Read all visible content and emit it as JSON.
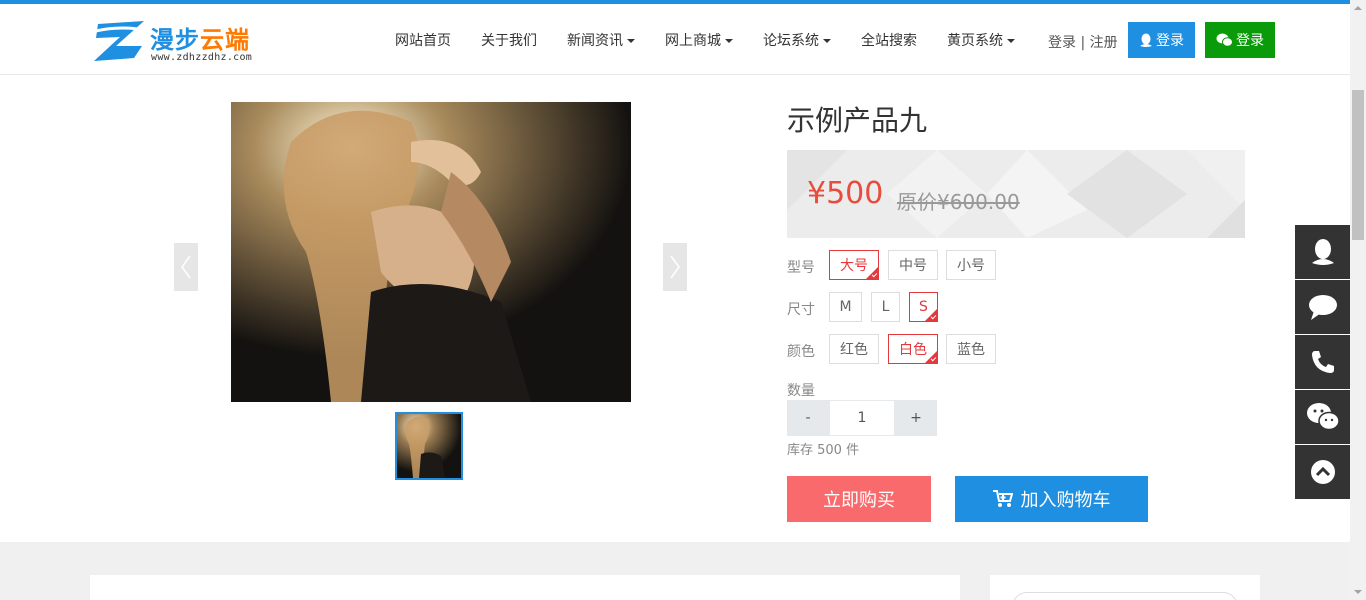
{
  "colors": {
    "accent": "#1e8fe1",
    "wechat_green": "#0a9a0a",
    "price_red": "#e84c3d",
    "buy_button": "#f86a6c",
    "selected_border": "#e4393c",
    "sidebar_dark": "#333333"
  },
  "logo": {
    "name_part1": "漫步",
    "name_part2": "云端",
    "url": "www.zdhzzdhz.com"
  },
  "nav": [
    {
      "label": "网站首页",
      "dropdown": false
    },
    {
      "label": "关于我们",
      "dropdown": false
    },
    {
      "label": "新闻资讯",
      "dropdown": true
    },
    {
      "label": "网上商城",
      "dropdown": true
    },
    {
      "label": "论坛系统",
      "dropdown": true
    },
    {
      "label": "全站搜索",
      "dropdown": false
    },
    {
      "label": "黄页系统",
      "dropdown": true
    }
  ],
  "auth": {
    "login": "登录",
    "separator": "|",
    "register": "注册",
    "qq_login": "登录",
    "wechat_login": "登录"
  },
  "product": {
    "title": "示例产品九",
    "price": "¥500",
    "original_price": "原价¥600.00",
    "options": [
      {
        "label": "型号",
        "values": [
          "大号",
          "中号",
          "小号"
        ],
        "selected": 0
      },
      {
        "label": "尺寸",
        "values": [
          "M",
          "L",
          "S"
        ],
        "selected": 2
      },
      {
        "label": "颜色",
        "values": [
          "红色",
          "白色",
          "蓝色"
        ],
        "selected": 1
      }
    ],
    "quantity_label": "数量",
    "quantity": "1",
    "minus": "-",
    "plus": "+",
    "stock": "库存 500 件",
    "buy_now": "立即购买",
    "add_to_cart": "加入购物车"
  },
  "side_tools": [
    "qq-icon",
    "chat-bubble-icon",
    "phone-icon",
    "wechat-icon",
    "back-to-top-icon"
  ]
}
